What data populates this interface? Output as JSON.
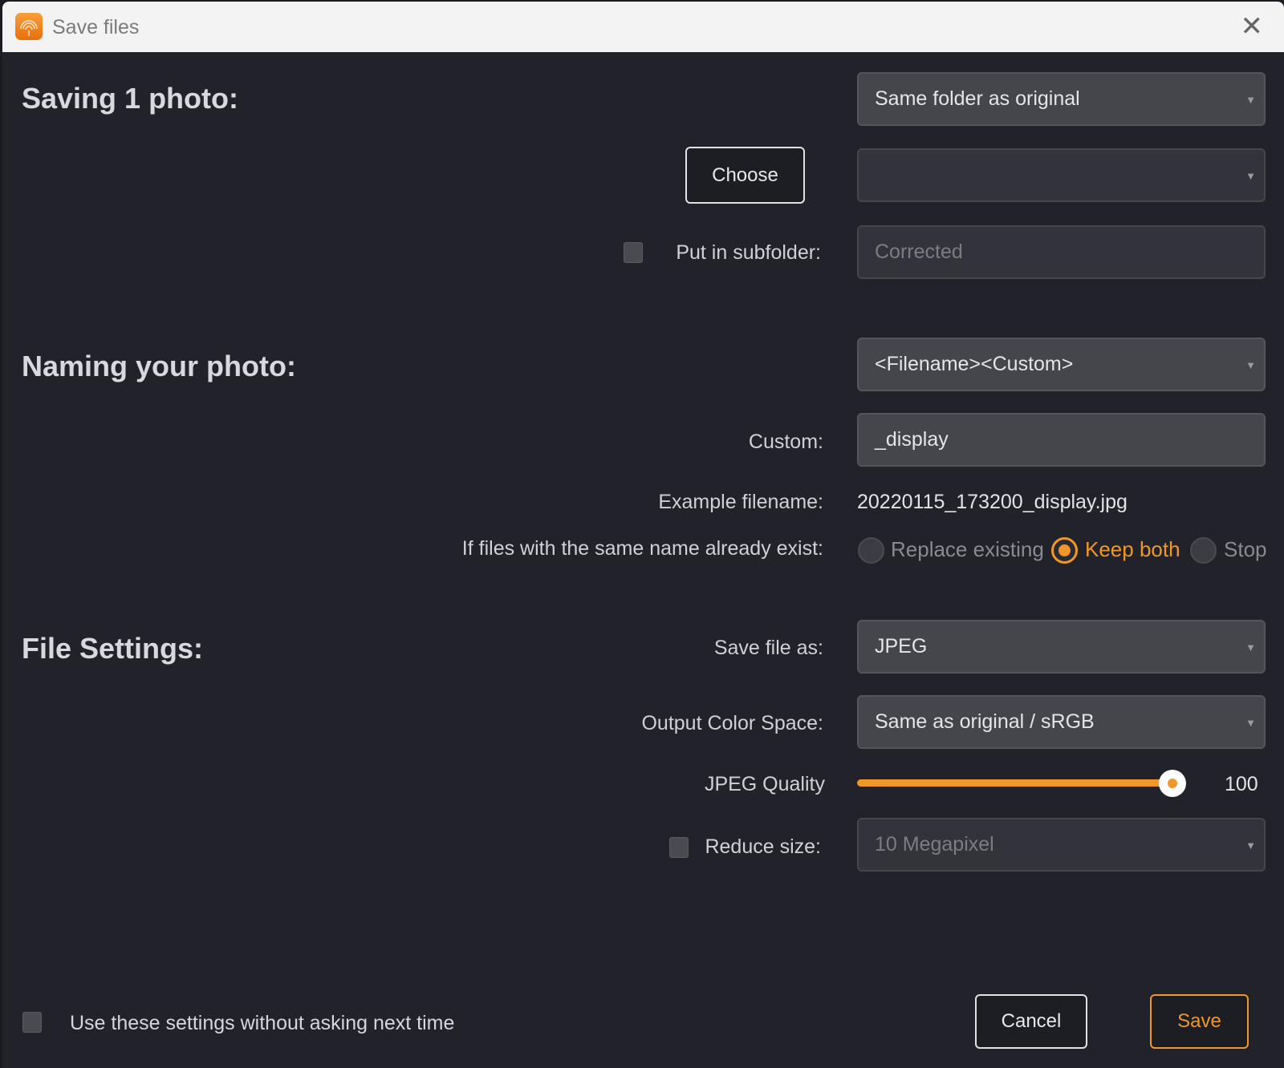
{
  "window": {
    "title": "Save files",
    "close_icon": "close-icon",
    "app_icon": "app-logo-icon"
  },
  "saving": {
    "heading": "Saving 1 photo:",
    "location": "Same folder as original",
    "choose": "Choose",
    "folder_value": "",
    "subfolder_label": "Put in subfolder:",
    "subfolder_checked": false,
    "subfolder_value": "Corrected"
  },
  "naming": {
    "heading": "Naming your photo:",
    "pattern": "<Filename><Custom>",
    "custom_label": "Custom:",
    "custom_value": "_display",
    "example_label": "Example filename:",
    "example_value": "20220115_173200_display.jpg",
    "conflict_label": "If files with the same name already exist:",
    "options": [
      "Replace existing",
      "Keep both",
      "Stop"
    ],
    "selected": "Keep both"
  },
  "file": {
    "heading": "File Settings:",
    "format_label": "Save file as:",
    "format": "JPEG",
    "colorspace_label": "Output Color Space:",
    "colorspace": "Same as original / sRGB",
    "quality_label": "JPEG Quality",
    "quality": "100",
    "quality_max": 100,
    "reduce_label": "Reduce size:",
    "reduce_checked": false,
    "reduce_value": "10 Megapixel"
  },
  "footer": {
    "remember_label": "Use these settings without asking next time",
    "remember_checked": false,
    "cancel": "Cancel",
    "save": "Save"
  },
  "colors": {
    "accent": "#f0972a",
    "background": "#22232a"
  }
}
